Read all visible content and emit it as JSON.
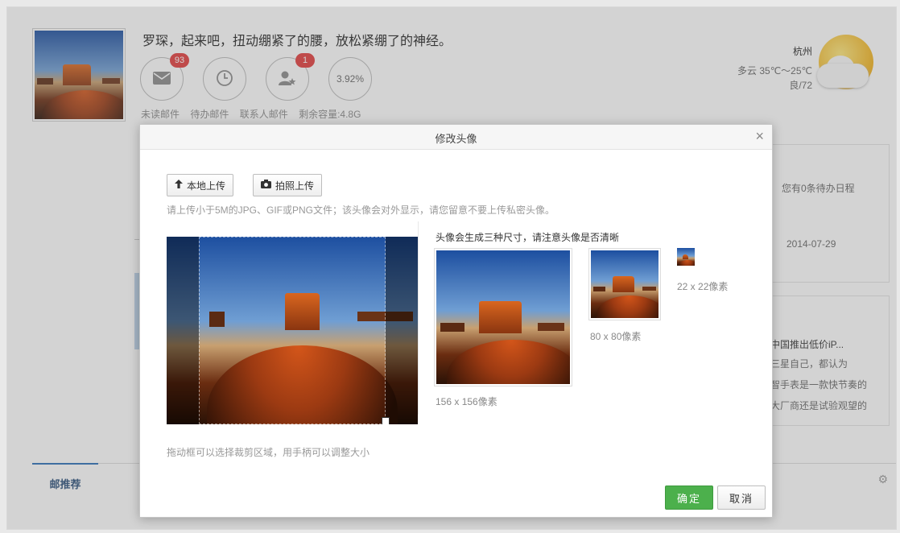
{
  "profile": {
    "greeting": "罗琛，起来吧，扭动绷紧了的腰，放松紧绷了的神经。",
    "stats": {
      "unread_badge": "93",
      "contacts_badge": "1",
      "storage_percent": "3.92%"
    },
    "labels": {
      "unread": "未读邮件",
      "pending": "待办邮件",
      "contacts": "联系人邮件",
      "storage": "剩余容量:4.8G"
    }
  },
  "weather": {
    "city": "杭州",
    "forecast": "多云 35℃～25℃",
    "aqi": "良/72"
  },
  "side": {
    "schedule_text": "您有0条待办日程",
    "schedule_date": "2014-07-29",
    "news_title": "中国推出低价iP...",
    "news_line1": "三星自己，都认为",
    "news_line2": "智手表是一款快节奏的",
    "news_line3": "大厂商还是试验观望的"
  },
  "bottom": {
    "tab_label": "邮推荐"
  },
  "dialog": {
    "title": "修改头像",
    "close": "×",
    "local_upload": "本地上传",
    "photo_upload": "拍照上传",
    "hint": "请上传小于5M的JPG、GIF或PNG文件；该头像会对外显示，请您留意不要上传私密头像。",
    "preview_title": "头像会生成三种尺寸，请注意头像是否清晰",
    "size_large": "156 x 156像素",
    "size_medium": "80 x 80像素",
    "size_small": "22 x 22像素",
    "crop_hint": "拖动框可以选择裁剪区域，用手柄可以调整大小",
    "ok": "确定",
    "cancel": "取消"
  },
  "colors": {
    "accent_green": "#4cb04c",
    "badge_red": "#e23c3c",
    "link_blue": "#2a6fb6"
  },
  "icons": {
    "upload": "arrow-up-icon",
    "camera": "camera-icon",
    "mail": "envelope-icon",
    "clock": "clock-icon",
    "contact": "contact-star-icon",
    "close": "close-icon",
    "settings": "gear-icon"
  }
}
